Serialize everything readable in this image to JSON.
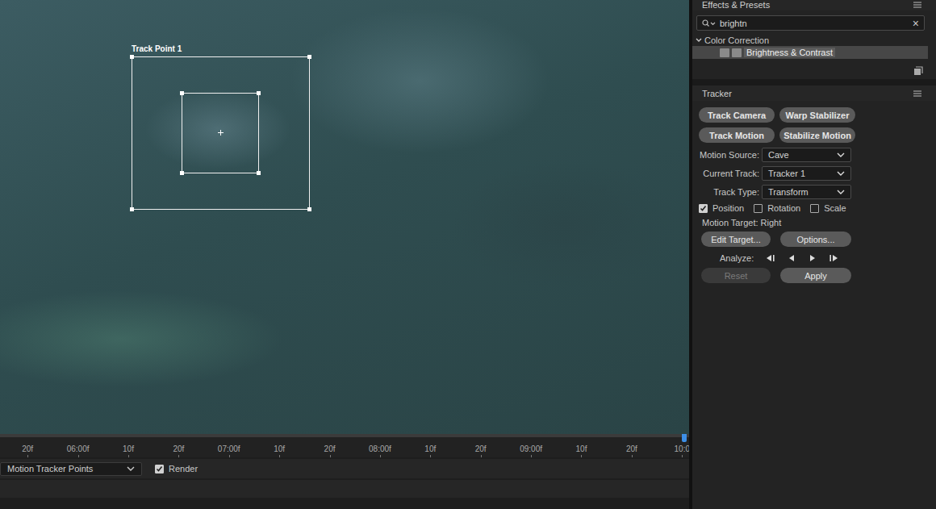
{
  "viewer": {
    "track_point": {
      "label": "Track Point 1"
    }
  },
  "timeline": {
    "ticks": [
      "20f",
      "06:00f",
      "10f",
      "20f",
      "07:00f",
      "10f",
      "20f",
      "08:00f",
      "10f",
      "20f",
      "09:00f",
      "10f",
      "20f",
      "10:0"
    ],
    "playhead": {
      "level": 0.995
    }
  },
  "viewer_bar": {
    "view_select": {
      "value": "Motion Tracker Points"
    },
    "render": {
      "label": "Render",
      "checked": true
    }
  },
  "effects_presets": {
    "title": "Effects & Presets",
    "search": {
      "value": "brightn",
      "clear": "×"
    },
    "tree": [
      {
        "label": "Color Correction",
        "expanded": true,
        "children": [
          {
            "label": "Brightness & Contrast",
            "selected": true
          }
        ]
      }
    ]
  },
  "tracker": {
    "title": "Tracker",
    "buttons": [
      {
        "label": "Track Camera"
      },
      {
        "label": "Warp Stabilizer"
      },
      {
        "label": "Track Motion"
      },
      {
        "label": "Stabilize Motion"
      }
    ],
    "fields": [
      {
        "label": "Motion Source:",
        "value": "Cave"
      },
      {
        "label": "Current Track:",
        "value": "Tracker 1"
      },
      {
        "label": "Track Type:",
        "value": "Transform"
      }
    ],
    "checkboxes": [
      {
        "label": "Position",
        "checked": true
      },
      {
        "label": "Rotation",
        "checked": false
      },
      {
        "label": "Scale",
        "checked": false
      }
    ],
    "motion_target": "Motion Target: Right",
    "target_buttons": [
      {
        "label": "Edit Target..."
      },
      {
        "label": "Options..."
      }
    ],
    "analyze": {
      "label": "Analyze:"
    },
    "bottom_buttons": [
      {
        "label": "Reset",
        "disabled": true
      },
      {
        "label": "Apply",
        "disabled": false
      }
    ]
  }
}
